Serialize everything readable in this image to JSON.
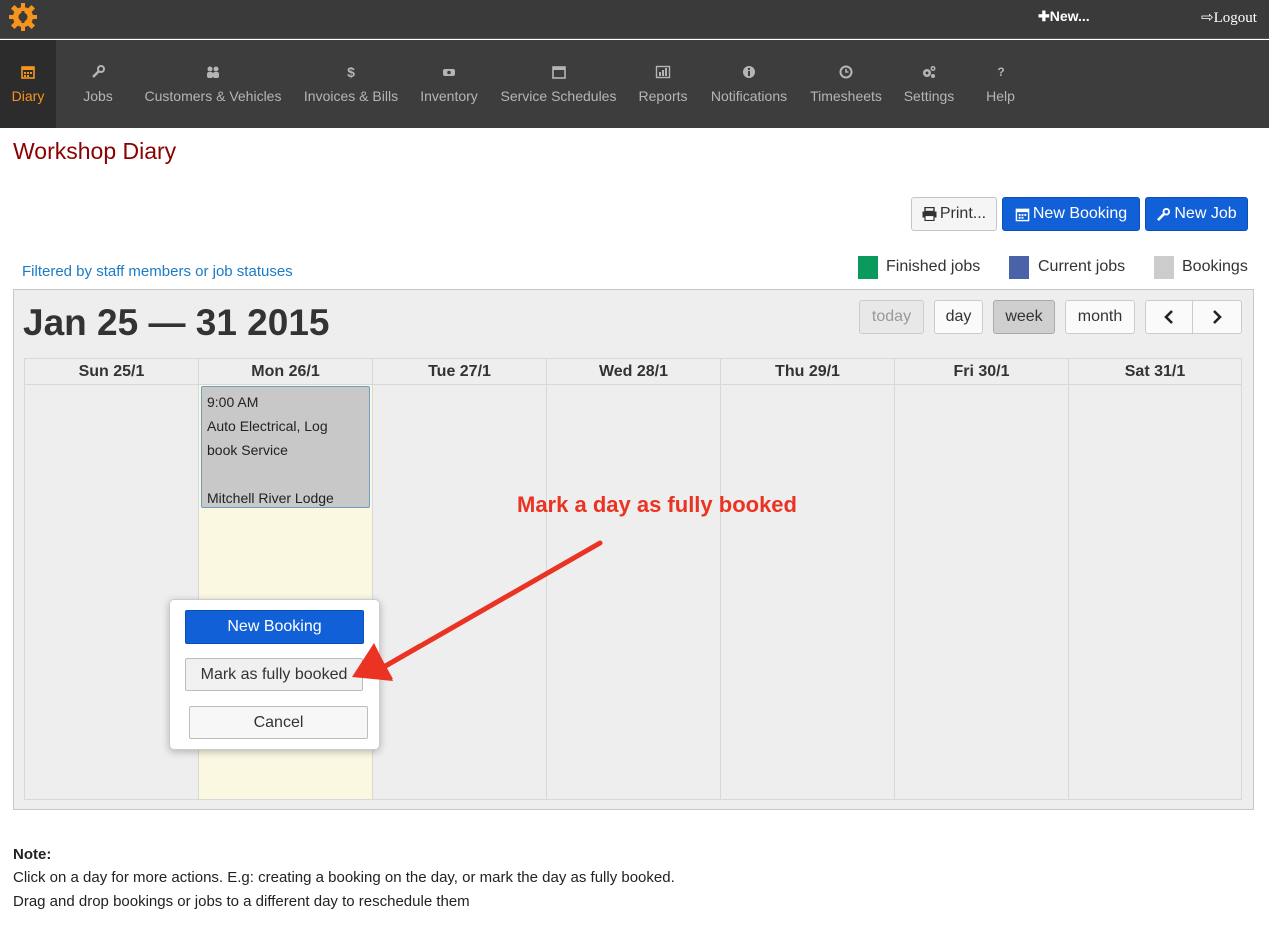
{
  "topbar": {
    "new_label": "New...",
    "logout_label": "Logout"
  },
  "nav": {
    "items": [
      {
        "label": "Diary",
        "icon": "calendar-icon",
        "active": true
      },
      {
        "label": "Jobs",
        "icon": "wrench-icon"
      },
      {
        "label": "Customers & Vehicles",
        "icon": "users-icon"
      },
      {
        "label": "Invoices & Bills",
        "icon": "dollar-icon"
      },
      {
        "label": "Inventory",
        "icon": "exchange-icon"
      },
      {
        "label": "Service Schedules",
        "icon": "calendar-empty-icon"
      },
      {
        "label": "Reports",
        "icon": "bar-chart-icon"
      },
      {
        "label": "Notifications",
        "icon": "info-icon"
      },
      {
        "label": "Timesheets",
        "icon": "clock-icon"
      },
      {
        "label": "Settings",
        "icon": "gears-icon"
      },
      {
        "label": "Help",
        "icon": "question-icon"
      }
    ],
    "active_color": "#f7941d"
  },
  "page": {
    "title": "Workshop Diary"
  },
  "toolbar": {
    "print_label": "Print...",
    "new_booking_label": "New Booking",
    "new_job_label": "New Job"
  },
  "filter": {
    "link_text": "Filtered by staff members or job statuses"
  },
  "legend": [
    {
      "label": "Finished jobs",
      "color": "#0a9a5c"
    },
    {
      "label": "Current jobs",
      "color": "#4a63a8"
    },
    {
      "label": "Bookings",
      "color": "#cccccc"
    }
  ],
  "calendar": {
    "range_title": "Jan 25 — 31 2015",
    "buttons": {
      "today": "today",
      "day": "day",
      "week": "week",
      "month": "month",
      "prev": "‹",
      "next": "›"
    },
    "active_view": "week",
    "days": [
      "Sun 25/1",
      "Mon 26/1",
      "Tue 27/1",
      "Wed 28/1",
      "Thu 29/1",
      "Fri 30/1",
      "Sat 31/1"
    ],
    "today_index": 1,
    "event": {
      "time": "9:00 AM",
      "line1": "Auto Electrical, Log",
      "line2": "book Service",
      "customer": "Mitchell River Lodge"
    }
  },
  "annotation": {
    "text": "Mark a day as fully booked",
    "color": "#ea3323"
  },
  "popup": {
    "new_booking": "New Booking",
    "mark_full": "Mark as fully booked",
    "cancel": "Cancel"
  },
  "note": {
    "title": "Note:",
    "line1": "Click on a day for more actions. E.g: creating a booking on the day, or mark the day as fully booked.",
    "line2": "Drag and drop bookings or jobs to a different day to reschedule them"
  }
}
